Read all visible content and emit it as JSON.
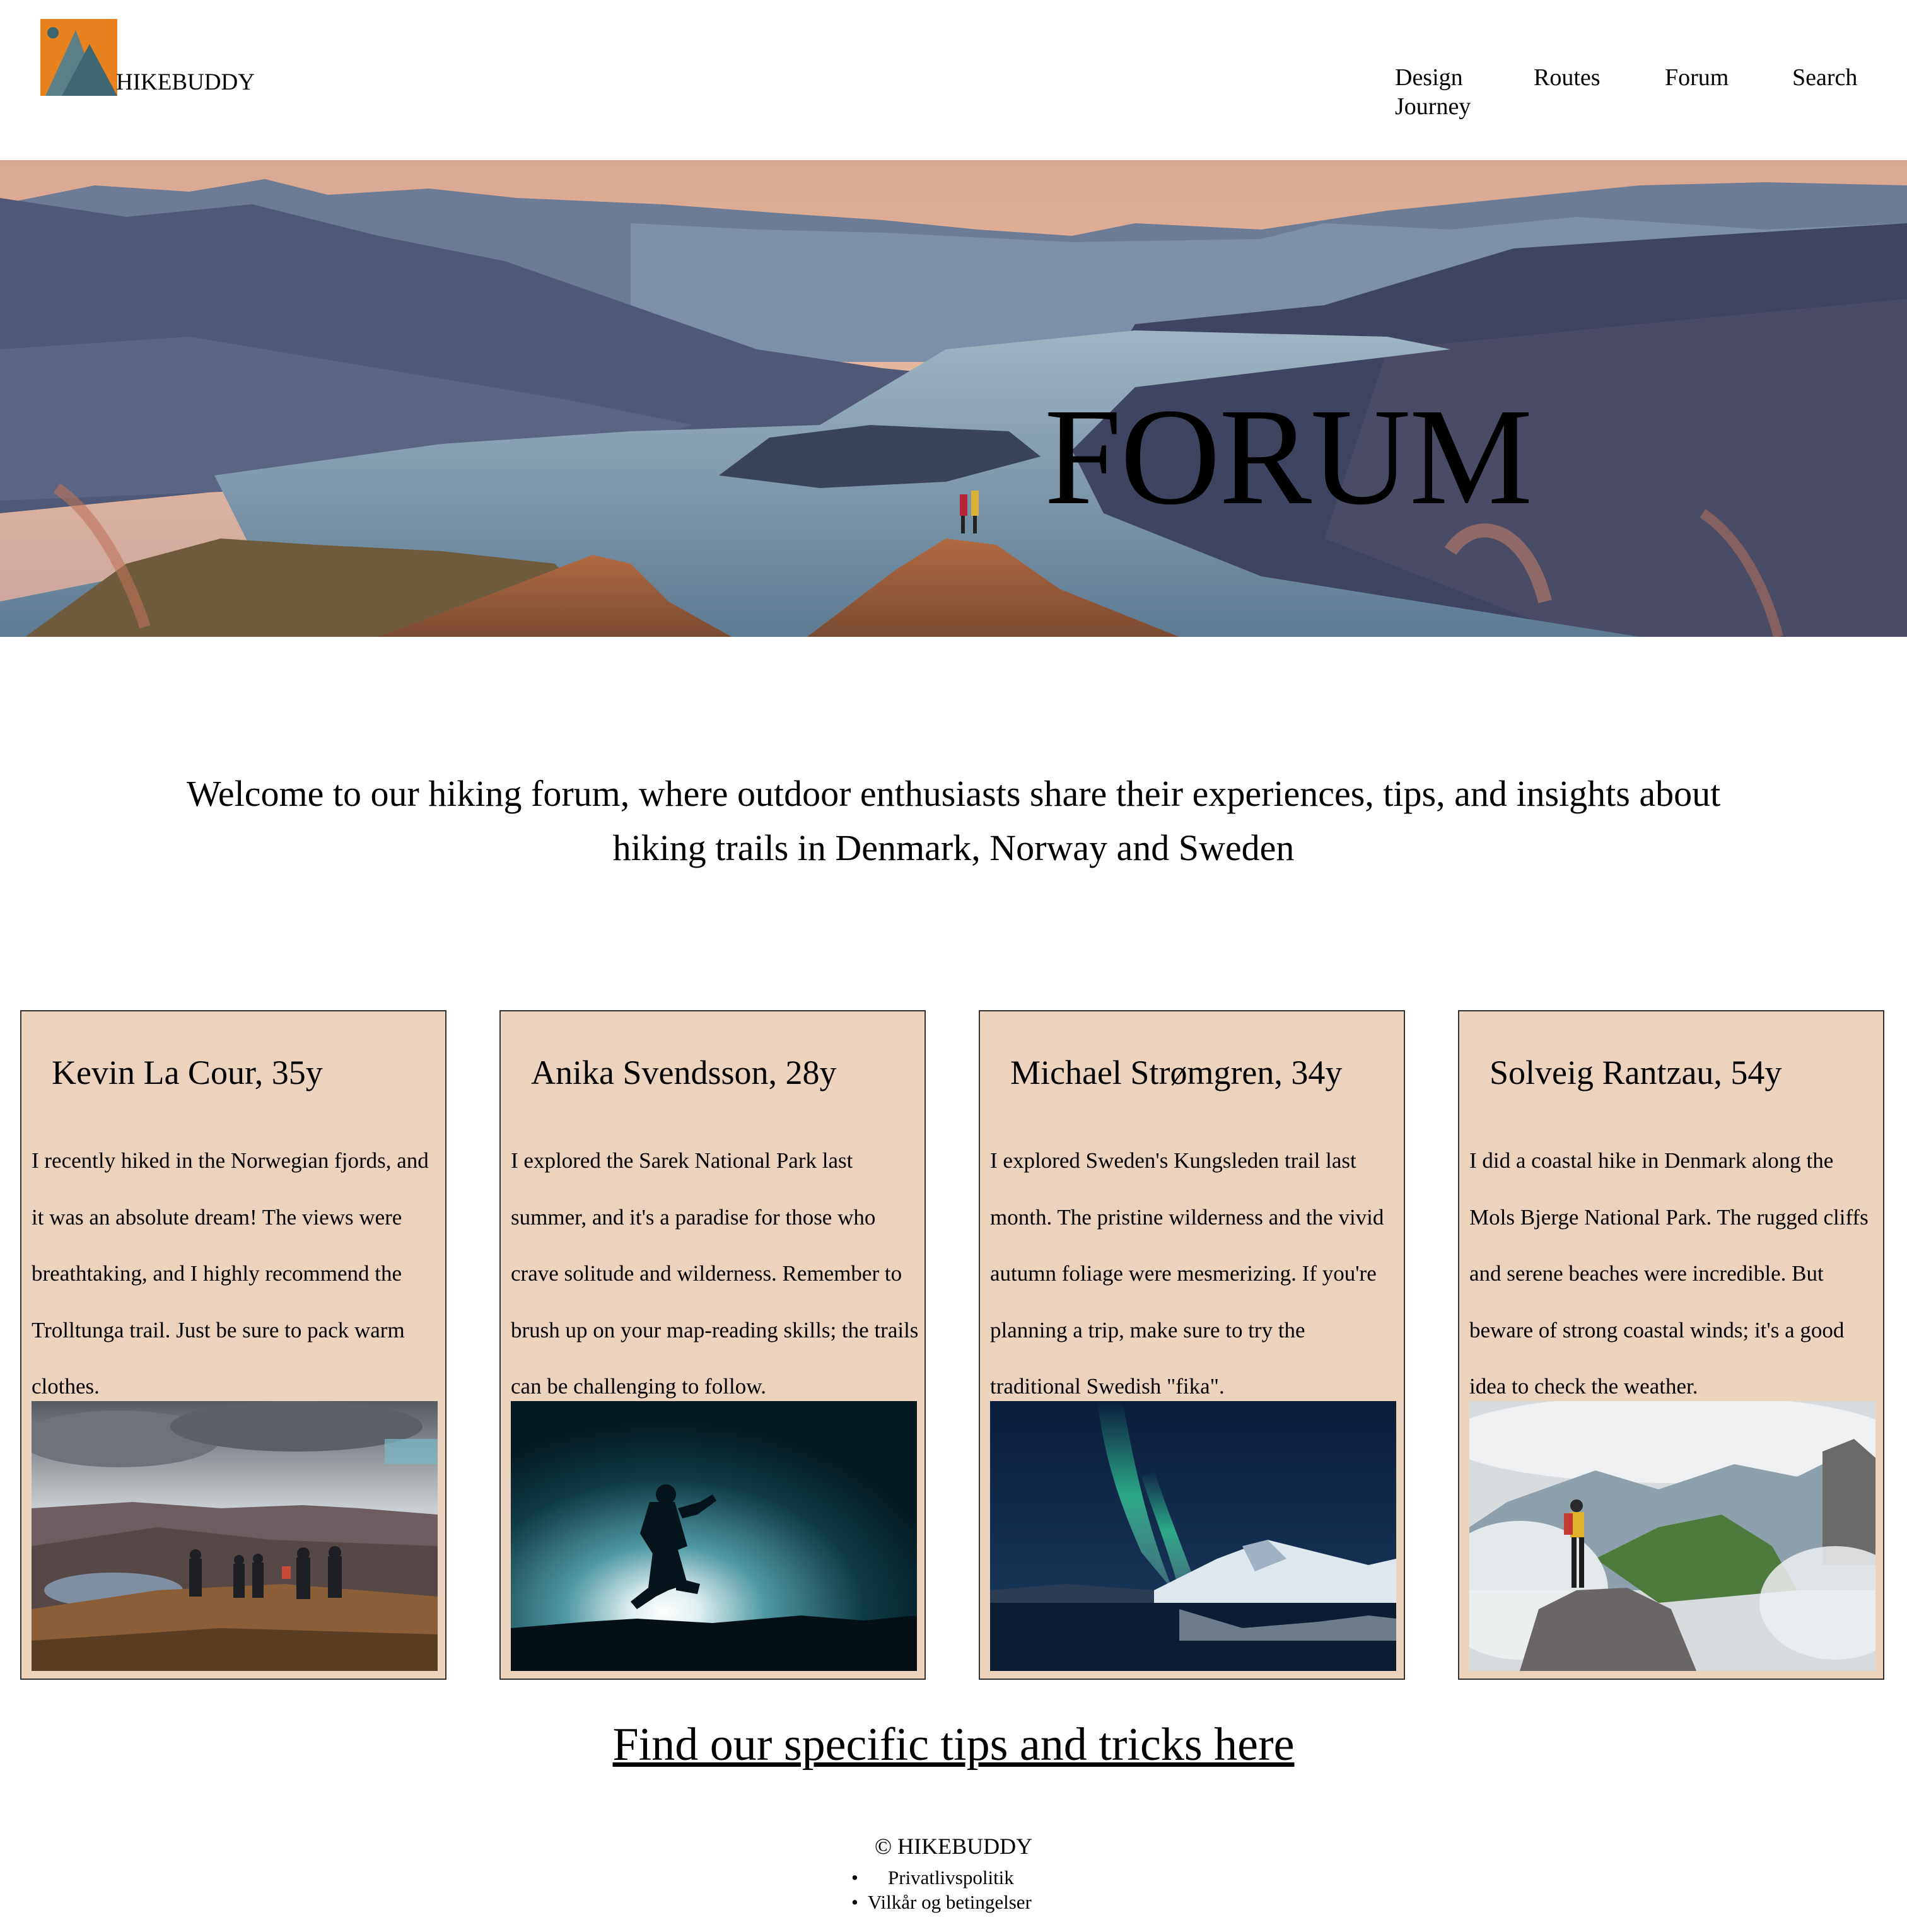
{
  "header": {
    "brand": "HIKEBUDDY",
    "nav": [
      {
        "label": "Design Journey"
      },
      {
        "label": "Routes"
      },
      {
        "label": "Forum"
      },
      {
        "label": "Search"
      }
    ]
  },
  "hero": {
    "title": "FORUM"
  },
  "intro": {
    "text": "Welcome to our hiking forum, where outdoor enthusiasts share their experiences, tips, and insights about hiking trails in Denmark, Norway and Sweden"
  },
  "posts": [
    {
      "author": "Kevin La Cour, 35y",
      "text": "I recently hiked in the Norwegian fjords, and it was an absolute dream! The views were breathtaking, and I highly recommend the Trolltunga trail. Just be sure to pack warm clothes."
    },
    {
      "author": "Anika Svendsson, 28y",
      "text": "I explored the Sarek National Park last summer, and it's a paradise for those who crave solitude and wilderness. Remember to brush up on your map-reading skills; the trails can be challenging to follow."
    },
    {
      "author": "Michael Strømgren, 34y",
      "text": "I explored Sweden's Kungsleden trail last month. The pristine wilderness and the vivid autumn foliage were mesmerizing. If you're planning a trip, make sure to try the traditional Swedish \"fika\"."
    },
    {
      "author": "Solveig Rantzau, 54y",
      "text": "I did a coastal hike in Denmark along the Mols Bjerge National Park. The rugged cliffs and serene beaches were incredible. But beware of strong coastal winds; it's a good idea to check the weather."
    }
  ],
  "tips_link": "Find our specific tips and tricks here",
  "footer": {
    "copyright": "© HIKEBUDDY",
    "links": [
      "Privatlivspolitik",
      "Vilkår og betingelser"
    ]
  },
  "colors": {
    "card_bg": "#ecd3be",
    "logo_orange": "#e8821e",
    "logo_slate": "#3e6670"
  }
}
